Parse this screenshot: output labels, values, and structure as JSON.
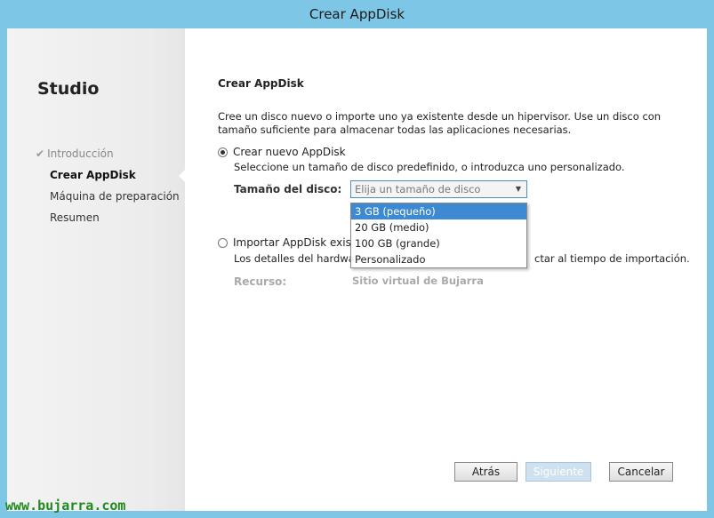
{
  "window": {
    "title": "Crear AppDisk"
  },
  "sidebar": {
    "title": "Studio",
    "steps": [
      {
        "label": "Introducción",
        "state": "done"
      },
      {
        "label": "Crear AppDisk",
        "state": "active"
      },
      {
        "label": "Máquina de preparación",
        "state": "pending"
      },
      {
        "label": "Resumen",
        "state": "pending"
      }
    ]
  },
  "main": {
    "heading": "Crear AppDisk",
    "description": "Cree un disco nuevo o importe uno ya existente desde un hipervisor. Use un disco con tamaño suficiente para almacenar todas las aplicaciones necesarias.",
    "option_new": {
      "label": "Crear nuevo AppDisk",
      "selected": true,
      "subtext": "Seleccione un tamaño de disco predefinido, o introduzca uno personalizado."
    },
    "disk_size": {
      "label": "Tamaño del disco:",
      "placeholder": "Elija un tamaño de disco",
      "options": [
        "3 GB (pequeño)",
        "20 GB (medio)",
        "100 GB (grande)",
        "Personalizado"
      ],
      "highlighted_index": 0
    },
    "option_import": {
      "label_visible": "Importar AppDisk existen",
      "selected": false,
      "subtext_left": "Los detalles del hardware",
      "subtext_right": "ctar al tiempo de importación."
    },
    "resource": {
      "label": "Recurso:",
      "value": "Sitio virtual de Bujarra"
    }
  },
  "footer": {
    "back_label": "Atrás",
    "next_label": "Siguiente",
    "cancel_label": "Cancelar"
  },
  "watermark": "www.bujarra.com",
  "colors": {
    "titlebar": "#7ec6e6",
    "accent": "#3d8ad2",
    "watermark": "#1f8a1f"
  }
}
